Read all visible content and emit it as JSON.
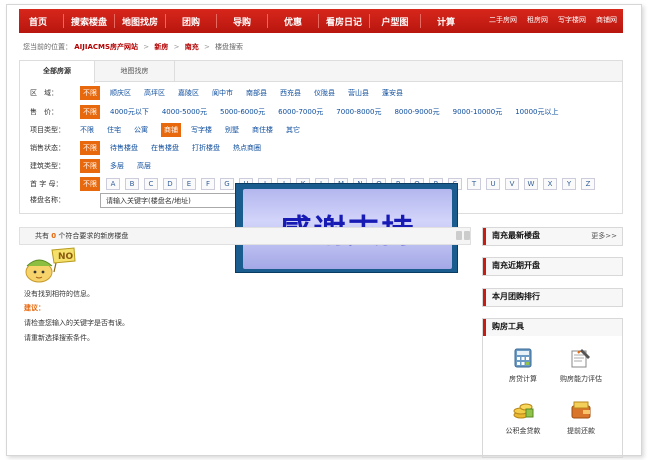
{
  "nav": {
    "items": [
      "首页",
      "搜索楼盘",
      "地图找房",
      "团购",
      "导购",
      "优惠",
      "看房日记",
      "户型图",
      "计算"
    ],
    "right": [
      "二手房网",
      "租房网",
      "写字楼网",
      "商铺网"
    ]
  },
  "breadcrumb": {
    "prefix": "您当前的位置：",
    "site": "AIJIACMS房产网站",
    "items": [
      "新房",
      "南充",
      "楼盘搜索"
    ],
    "sep": ">"
  },
  "search": {
    "tabs": [
      "全部房源",
      "地图找房"
    ],
    "rows": [
      {
        "label": "区　域：",
        "options": [
          "不限",
          "顺庆区",
          "高坪区",
          "嘉陵区",
          "阆中市",
          "南部县",
          "西充县",
          "仪陇县",
          "营山县",
          "蓬安县"
        ],
        "selected": 0
      },
      {
        "label": "售　价：",
        "options": [
          "不限",
          "4000元以下",
          "4000-5000元",
          "5000-6000元",
          "6000-7000元",
          "7000-8000元",
          "8000-9000元",
          "9000-10000元",
          "10000元以上"
        ],
        "selected": 0
      },
      {
        "label": "项目类型：",
        "options": [
          "不限",
          "住宅",
          "公寓",
          "商铺",
          "写字楼",
          "别墅",
          "商住楼",
          "其它"
        ],
        "selected": 3
      },
      {
        "label": "销售状态：",
        "options": [
          "不限",
          "待售楼盘",
          "在售楼盘",
          "打折楼盘",
          "热点商圈"
        ],
        "selected": 0
      },
      {
        "label": "建筑类型：",
        "options": [
          "不限",
          "多层",
          "高层"
        ],
        "selected": 0
      }
    ],
    "letter_label": "首 字 母：",
    "letter_any": "不限",
    "letters": [
      "A",
      "B",
      "C",
      "D",
      "E",
      "F",
      "G",
      "H",
      "I",
      "J",
      "K",
      "L",
      "M",
      "N",
      "O",
      "P",
      "Q",
      "R",
      "S",
      "T",
      "U",
      "V",
      "W",
      "X",
      "Y",
      "Z"
    ],
    "keyword_label": "楼盘名称：",
    "keyword_value": "请输入关键字(楼盘名/地址)"
  },
  "banner": {
    "text": "感谢支持"
  },
  "results": {
    "prefix": "共有",
    "count": "0",
    "suffix": "个符合要求的新房楼盘",
    "mascot_label": "NO",
    "no_result": "没有找到相符的信息。",
    "tip_title": "建议：",
    "tips": [
      "请检查您输入的关键字是否有误。",
      "请重新选择搜索条件。"
    ]
  },
  "sidebar": {
    "latest": "南充最新楼盘",
    "more": "更多>>",
    "opening": "南充近期开盘",
    "group_rank": "本月团购排行",
    "tools_title": "购房工具",
    "tools": [
      {
        "label": "房贷计算",
        "icon": "calculator-icon"
      },
      {
        "label": "购房能力评估",
        "icon": "evaluation-icon"
      },
      {
        "label": "公积金贷款",
        "icon": "coins-icon"
      },
      {
        "label": "提前还款",
        "icon": "wallet-icon"
      }
    ]
  },
  "colors": {
    "nav": "#c81d14",
    "accent": "#e8680d",
    "link": "#0d4d9e",
    "banner_text": "#181ab4"
  }
}
